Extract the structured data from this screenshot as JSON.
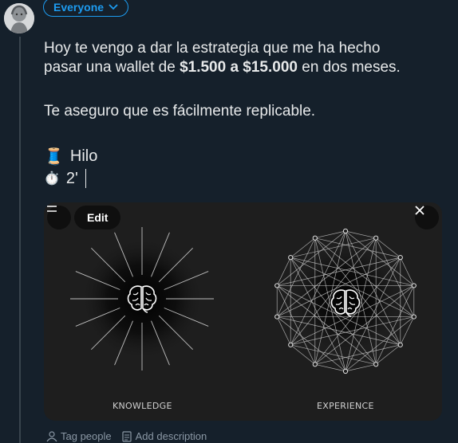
{
  "audience": {
    "label": "Everyone"
  },
  "post": {
    "line1": "Hoy te vengo a dar la estrategia que me ha hecho",
    "line2_prefix": "pasar una wallet de ",
    "line2_bold": "$1.500 a $15.000",
    "line2_suffix": " en dos meses.",
    "line3": "Te aseguro que es fácilmente replicable.",
    "thread_emoji": "🧵",
    "thread_label": "Hilo",
    "timer_emoji": "⏱️",
    "timer_label": "2'"
  },
  "media": {
    "edit_label": "Edit",
    "left_caption": "KNOWLEDGE",
    "right_caption": "EXPERIENCE"
  },
  "footer": {
    "tag_people": "Tag people",
    "add_description": "Add description"
  },
  "colors": {
    "background": "#15202b",
    "accent": "#1d9bf0",
    "media_bg": "#1e1e1e"
  }
}
